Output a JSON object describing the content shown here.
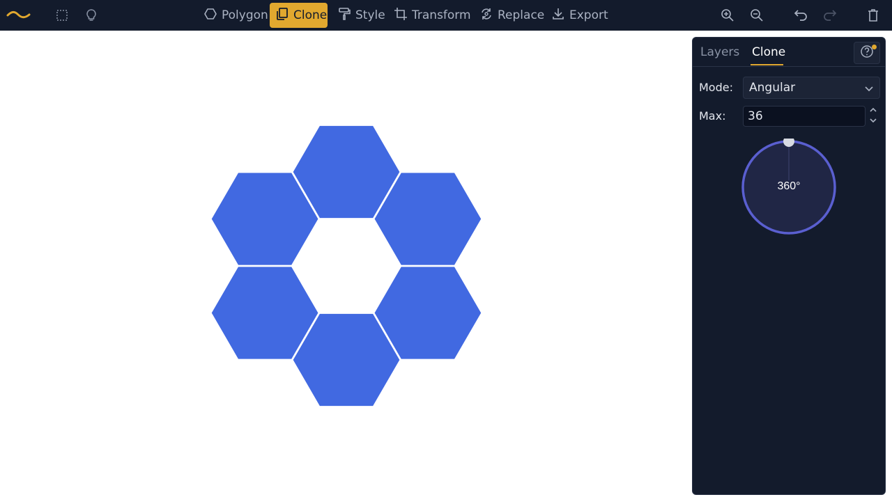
{
  "toolbar": {
    "tools": [
      {
        "name": "polygon",
        "label": "Polygon",
        "active": false
      },
      {
        "name": "clone",
        "label": "Clone",
        "active": true
      },
      {
        "name": "style",
        "label": "Style",
        "active": false
      },
      {
        "name": "transform",
        "label": "Transform",
        "active": false
      },
      {
        "name": "replace",
        "label": "Replace",
        "active": false
      },
      {
        "name": "export",
        "label": "Export",
        "active": false
      }
    ],
    "left_icons": [
      "logo-icon",
      "select-icon",
      "lightbulb-icon"
    ],
    "right_icons": [
      "zoom-in-icon",
      "zoom-out-icon",
      "undo-icon",
      "redo-icon",
      "trash-icon"
    ]
  },
  "canvas": {
    "shape_color": "#4169e1",
    "shape_count": 6
  },
  "panel": {
    "tabs": [
      {
        "label": "Layers",
        "active": false
      },
      {
        "label": "Clone",
        "active": true
      }
    ],
    "mode": {
      "label": "Mode:",
      "value": "Angular"
    },
    "max": {
      "label": "Max:",
      "value": "36"
    },
    "angle": {
      "label": "360°",
      "degrees": 360
    }
  },
  "colors": {
    "toolbar_bg": "#131b2c",
    "accent": "#e1a82f",
    "dial": "#5a5fd0",
    "dial_fill": "#202645"
  }
}
